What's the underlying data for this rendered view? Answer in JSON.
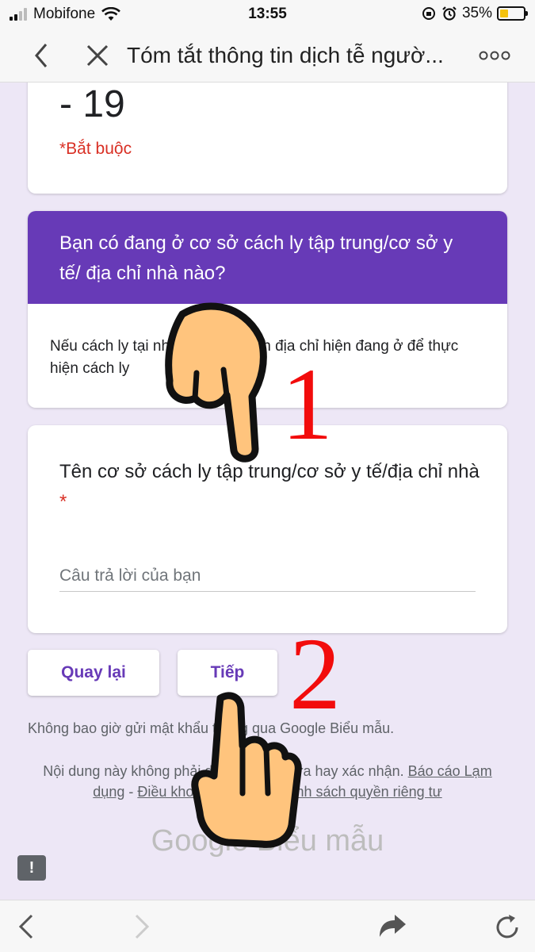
{
  "status_bar": {
    "carrier": "Mobifone",
    "time": "13:55",
    "battery": "35%"
  },
  "nav": {
    "title": "Tóm tắt thông tin dịch tễ ngườ..."
  },
  "card_top": {
    "text_partial": "- 19",
    "required": "*Bắt buộc"
  },
  "section": {
    "title": "Bạn có đang ở cơ sở cách ly tập trung/cơ sở y tế/ địa chỉ nhà nào?",
    "description": "Nếu cách ly tại nhà, vui lòng điền địa chỉ hiện đang ở để thực hiện cách ly"
  },
  "question": {
    "label": "Tên cơ sở cách ly tập trung/cơ sở y tế/địa chỉ nhà",
    "required_mark": "*",
    "placeholder": "Câu trả lời của bạn"
  },
  "buttons": {
    "back": "Quay lại",
    "next": "Tiếp"
  },
  "footer": {
    "warning": "Không bao giờ gửi mật khẩu thông qua Google Biểu mẫu.",
    "legal_text": "Nội dung này không phải do Google tạo ra hay xác nhận.",
    "report_link": "Báo cáo Lạm dụng",
    "separator": "-",
    "terms_link": "Điều khoản Dịch vụ",
    "privacy_link": "Chính sách quyền riêng tư",
    "brand_google": "Google",
    "brand_forms": "Biểu mẫu"
  },
  "feedback_icon": "!",
  "annotations": {
    "step1": "1",
    "step2": "2"
  },
  "colors": {
    "accent": "#673ab7",
    "required": "#d93025",
    "annotation": "#f20c0c"
  }
}
